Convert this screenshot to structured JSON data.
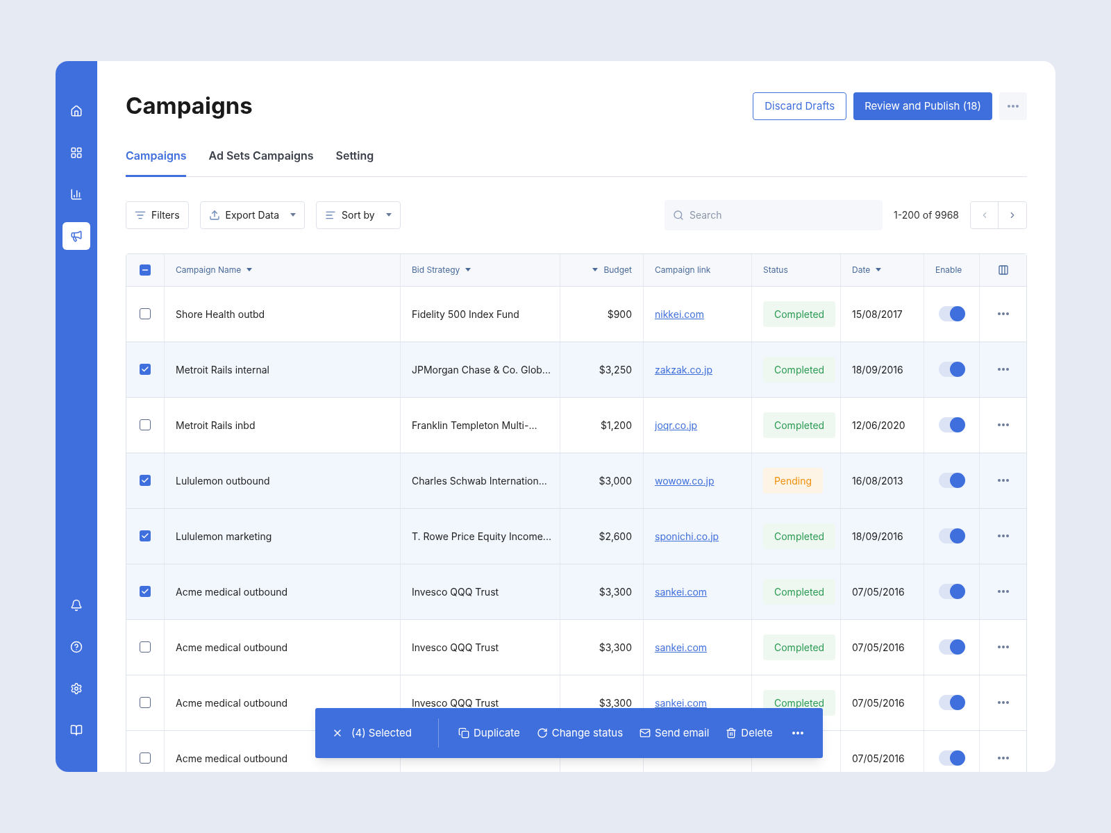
{
  "sidebar": {
    "items": [
      {
        "selected": false
      },
      {
        "selected": false
      },
      {
        "selected": false
      },
      {
        "selected": true
      }
    ],
    "bottom_items": [
      {
        "selected": false
      },
      {
        "selected": false
      },
      {
        "selected": false
      },
      {
        "selected": false
      }
    ]
  },
  "header": {
    "title": "Campaigns",
    "buttons": [
      {
        "label": "Discard Drafts",
        "kind": "outline"
      },
      {
        "label": "Review and Publish (18)",
        "kind": "primary"
      }
    ]
  },
  "tabs": [
    {
      "label": "Campaigns",
      "selected": true
    },
    {
      "label": "Ad Sets Campaigns",
      "selected": false
    },
    {
      "label": "Setting",
      "selected": false
    }
  ],
  "toolbar": {
    "buttons": [
      {
        "label": "Filters",
        "kind": "filter",
        "dropdown": false
      },
      {
        "label": "Export Data",
        "kind": "export",
        "dropdown": true
      },
      {
        "label": "Sort by",
        "kind": "sort",
        "dropdown": true
      }
    ],
    "search": {
      "placeholder": "Search"
    },
    "pagination": "1-200 of 9968"
  },
  "table": {
    "select_all": {
      "indeterminate": true
    },
    "columns": [
      {
        "label": "Campaign Name",
        "numeric": false,
        "caret": true
      },
      {
        "label": "Bid Strategy",
        "numeric": false,
        "caret": true
      },
      {
        "label": "Budget",
        "numeric": true,
        "caret": true
      },
      {
        "label": "Campaign link",
        "numeric": false,
        "caret": false
      },
      {
        "label": "Status",
        "numeric": false,
        "caret": false
      },
      {
        "label": "Date",
        "numeric": false,
        "caret": true
      },
      {
        "label": "Enable",
        "numeric": false,
        "caret": false
      }
    ],
    "rows": [
      {
        "selected": false,
        "name": "Shore Health outbd",
        "bid_strategy": "Fidelity 500 Index Fund",
        "budget": "$900",
        "link": "nikkei.com",
        "status": "Completed",
        "kind": "completed",
        "date": "15/08/2017",
        "enabled": true
      },
      {
        "selected": true,
        "name": "Metroit Rails internal",
        "bid_strategy": "JPMorgan Chase & Co. Glob...",
        "budget": "$3,250",
        "link": "zakzak.co.jp",
        "status": "Completed",
        "kind": "completed",
        "date": "18/09/2016",
        "enabled": true
      },
      {
        "selected": false,
        "name": "Metroit Rails inbd",
        "bid_strategy": "Franklin Templeton Multi-...",
        "budget": "$1,200",
        "link": "joqr.co.jp",
        "status": "Completed",
        "kind": "completed",
        "date": "12/06/2020",
        "enabled": true
      },
      {
        "selected": true,
        "name": "Lululemon outbound",
        "bid_strategy": "Charles Schwab Internation...",
        "budget": "$3,000",
        "link": "wowow.co.jp",
        "status": "Pending",
        "kind": "pending",
        "date": "16/08/2013",
        "enabled": true
      },
      {
        "selected": true,
        "name": "Lululemon marketing",
        "bid_strategy": "T. Rowe Price Equity Income...",
        "budget": "$2,600",
        "link": "sponichi.co.jp",
        "status": "Completed",
        "kind": "completed",
        "date": "18/09/2016",
        "enabled": true
      },
      {
        "selected": true,
        "name": "Acme medical outbound",
        "bid_strategy": "Invesco QQQ Trust",
        "budget": "$3,300",
        "link": "sankei.com",
        "status": "Completed",
        "kind": "completed",
        "date": "07/05/2016",
        "enabled": true
      },
      {
        "selected": false,
        "name": "Acme medical outbound",
        "bid_strategy": "Invesco QQQ Trust",
        "budget": "$3,300",
        "link": "sankei.com",
        "status": "Completed",
        "kind": "completed",
        "date": "07/05/2016",
        "enabled": true
      },
      {
        "selected": false,
        "name": "Acme medical outbound",
        "bid_strategy": "Invesco QQQ Trust",
        "budget": "$3,300",
        "link": "sankei.com",
        "status": "Completed",
        "kind": "completed",
        "date": "07/05/2016",
        "enabled": true
      },
      {
        "selected": false,
        "name": "Acme medical outbound",
        "date": "07/05/2016",
        "enabled": true
      }
    ]
  },
  "action_bar": {
    "selected_count": "(4) Selected",
    "actions": [
      {
        "label": "Duplicate",
        "kind": "duplicate"
      },
      {
        "label": "Change status",
        "kind": "status"
      },
      {
        "label": "Send email",
        "kind": "email"
      },
      {
        "label": "Delete",
        "kind": "delete"
      }
    ]
  }
}
